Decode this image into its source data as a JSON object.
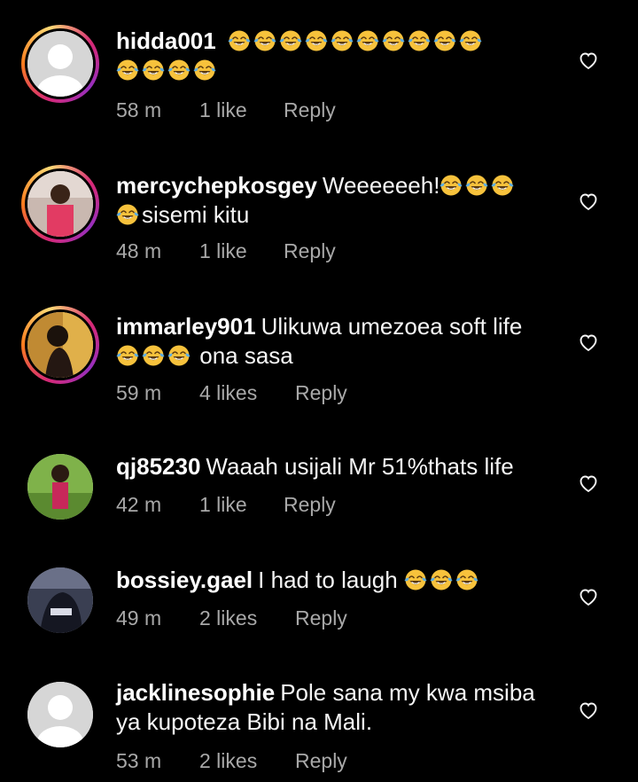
{
  "comments": [
    {
      "username": "hidda001",
      "text_lines": [
        "",
        ""
      ],
      "emoji_lines": [
        10,
        4
      ],
      "time": "58 m",
      "likes": "1 like",
      "reply": "Reply",
      "avatar": "default-avatar",
      "story_ring": true
    },
    {
      "username": "mercychepkosgey",
      "text_lines": [
        "Weeeeeeh!",
        "sisemi kitu"
      ],
      "emoji_lines": [
        3,
        1
      ],
      "time": "48 m",
      "likes": "1 like",
      "reply": "Reply",
      "avatar": "photo-avatar",
      "story_ring": true
    },
    {
      "username": "immarley901",
      "text_lines": [
        "Ulikuwa umezoea soft life",
        "ona sasa"
      ],
      "emoji_lines": [
        0,
        3
      ],
      "time": "59 m",
      "likes": "4 likes",
      "reply": "Reply",
      "avatar": "photo-avatar",
      "story_ring": true
    },
    {
      "username": "qj85230",
      "text_lines": [
        "Waaah usijali Mr 51%thats life"
      ],
      "emoji_lines": [
        0
      ],
      "time": "42 m",
      "likes": "1 like",
      "reply": "Reply",
      "avatar": "photo-avatar",
      "story_ring": false
    },
    {
      "username": "bossiey.gael",
      "text_lines": [
        "I had to laugh"
      ],
      "emoji_lines": [
        3
      ],
      "time": "49 m",
      "likes": "2 likes",
      "reply": "Reply",
      "avatar": "photo-avatar",
      "story_ring": false
    },
    {
      "username": "jacklinesophie",
      "text_lines": [
        "Pole sana my kwa msiba",
        "ya kupoteza Bibi na Mali."
      ],
      "emoji_lines": [
        0,
        0
      ],
      "time": "53 m",
      "likes": "2 likes",
      "reply": "Reply",
      "avatar": "default-avatar",
      "story_ring": false
    }
  ],
  "icons": {
    "emoji": "face-with-tears-of-joy",
    "like": "heart-outline-icon"
  },
  "colors": {
    "background": "#000000",
    "text": "#f5f5f5",
    "meta": "#a8a8a8",
    "emoji_face": "#f7c23c",
    "emoji_tears": "#5dade2"
  }
}
